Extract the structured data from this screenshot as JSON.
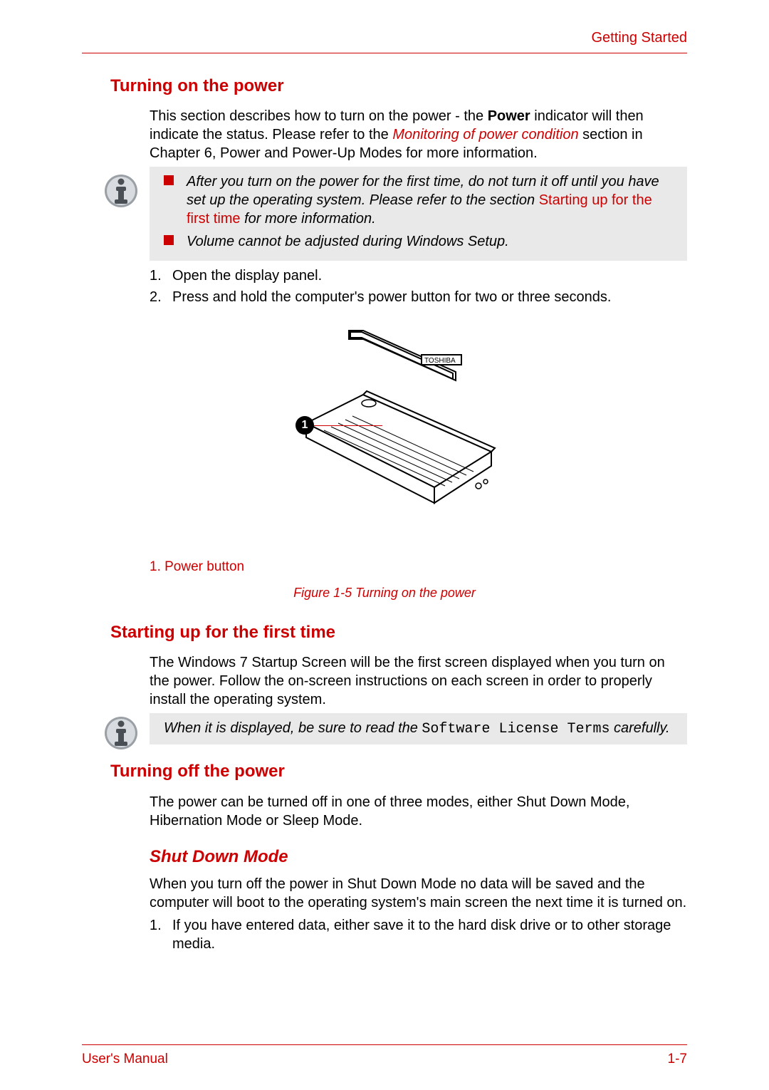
{
  "header": {
    "section": "Getting Started"
  },
  "s1": {
    "heading": "Turning on the power",
    "p1a": "This section describes how to turn on the power - the ",
    "p1b": "Power",
    "p1c": " indicator will then indicate the status. Please refer to the ",
    "p1link": "Monitoring of power condition",
    "p1d": " section in Chapter 6, Power and Power-Up Modes for more information.",
    "note1a": "After you turn on the power for the first time, do not turn it off until you have set up the operating system. Please refer to the section ",
    "note1link": "Starting up for the first time",
    "note1b": " for more information.",
    "note2": "Volume cannot be adjusted during Windows Setup.",
    "step1": "Open the display panel.",
    "step2": "Press and hold the computer's power button for two or three seconds.",
    "calloutNum": "1",
    "figLabel": "1. Power button",
    "figCaption": "Figure 1-5 Turning on the power",
    "brand": "TOSHIBA"
  },
  "s2": {
    "heading": "Starting up for the first time",
    "p1": "The Windows 7 Startup Screen will be the first screen displayed when you turn on the power. Follow the on-screen instructions on each screen in order to properly install the operating system.",
    "note_a": "When it is displayed, be sure to read the ",
    "note_code": "Software License Terms",
    "note_b": " carefully."
  },
  "s3": {
    "heading": "Turning off the power",
    "p1": "The power can be turned off in one of three modes, either Shut Down Mode, Hibernation Mode or Sleep Mode."
  },
  "s4": {
    "heading": "Shut Down Mode",
    "p1": "When you turn off the power in Shut Down Mode no data will be saved and the computer will boot to the operating system's main screen the next time it is turned on.",
    "step1": "If you have entered data, either save it to the hard disk drive or to other storage media."
  },
  "footer": {
    "left": "User's Manual",
    "right": "1-7"
  }
}
